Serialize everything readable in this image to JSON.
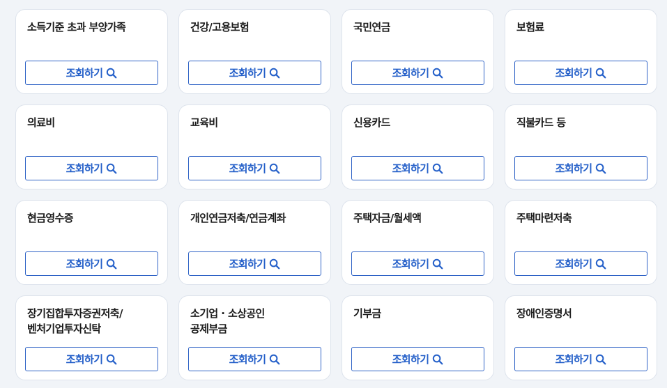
{
  "search_icon_color": "#2560c9",
  "cards": [
    {
      "title": "소득기준 초과 부양가족",
      "button_label": "조회하기",
      "button_icon": "search-icon"
    },
    {
      "title": "건강/고용보험",
      "button_label": "조회하기",
      "button_icon": "search-icon"
    },
    {
      "title": "국민연금",
      "button_label": "조회하기",
      "button_icon": "search-icon"
    },
    {
      "title": "보험료",
      "button_label": "조회하기",
      "button_icon": "search-icon"
    },
    {
      "title": "의료비",
      "button_label": "조회하기",
      "button_icon": "search-icon"
    },
    {
      "title": "교육비",
      "button_label": "조회하기",
      "button_icon": "search-icon"
    },
    {
      "title": "신용카드",
      "button_label": "조회하기",
      "button_icon": "search-icon"
    },
    {
      "title": "직불카드 등",
      "button_label": "조회하기",
      "button_icon": "search-icon"
    },
    {
      "title": "현금영수증",
      "button_label": "조회하기",
      "button_icon": "search-icon"
    },
    {
      "title": "개인연금저축/연금계좌",
      "button_label": "조회하기",
      "button_icon": "search-icon"
    },
    {
      "title": "주택자금/월세액",
      "button_label": "조회하기",
      "button_icon": "search-icon"
    },
    {
      "title": "주택마련저축",
      "button_label": "조회하기",
      "button_icon": "search-icon"
    },
    {
      "title": "장기집합투자증권저축/\n벤처기업투자신탁",
      "button_label": "조회하기",
      "button_icon": "search-icon"
    },
    {
      "title": "소기업 · 소상공인\n공제부금",
      "button_label": "조회하기",
      "button_icon": "search-icon"
    },
    {
      "title": "기부금",
      "button_label": "조회하기",
      "button_icon": "search-icon"
    },
    {
      "title": "장애인증명서",
      "button_label": "조회하기",
      "button_icon": "search-icon"
    }
  ]
}
